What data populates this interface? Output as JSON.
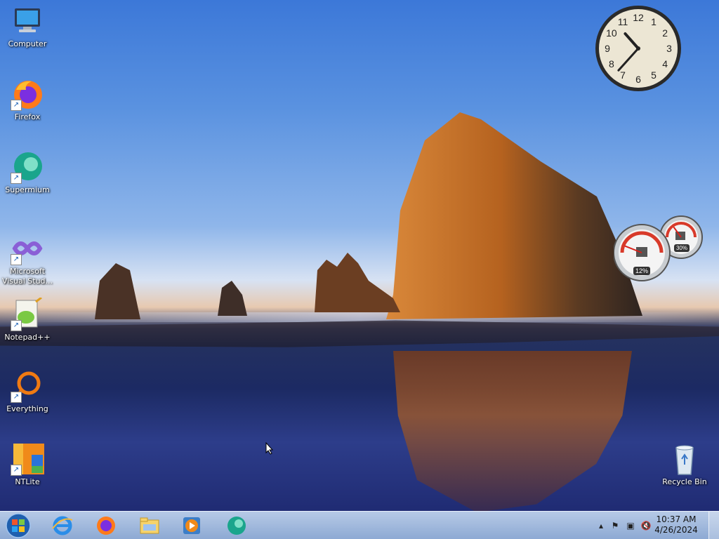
{
  "desktop": {
    "icons": [
      {
        "label": "Computer"
      },
      {
        "label": "Firefox"
      },
      {
        "label": "Supermium"
      },
      {
        "label": "Microsoft Visual Stud..."
      },
      {
        "label": "Notepad++"
      },
      {
        "label": "Everything"
      },
      {
        "label": "NTLite"
      },
      {
        "label": "Recycle Bin"
      }
    ]
  },
  "gadgets": {
    "clock": {
      "hour": 10,
      "minute": 37,
      "numbers": [
        "12",
        "1",
        "2",
        "3",
        "4",
        "5",
        "6",
        "7",
        "8",
        "9",
        "10",
        "11"
      ]
    },
    "meter": {
      "cpu_label": "12%",
      "memory_label": "30%",
      "cpu_value": 0.12,
      "memory_value": 0.3
    }
  },
  "taskbar": {
    "pinned": [
      "internet-explorer",
      "firefox",
      "file-explorer",
      "media-player",
      "supermium"
    ],
    "tray": {
      "time": "10:37 AM",
      "date": "4/26/2024"
    }
  },
  "colors": {
    "accent": "#3c78d8",
    "taskbar": "#a8c2e6"
  }
}
